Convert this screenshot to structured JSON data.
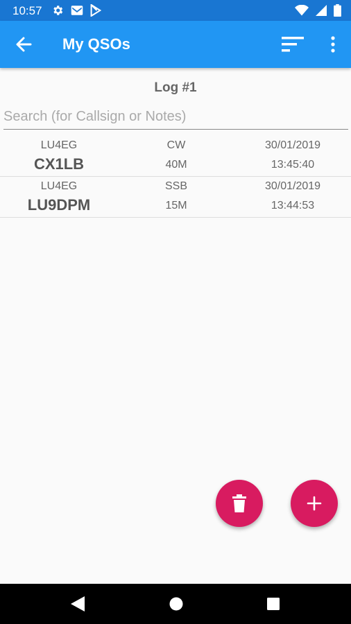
{
  "status_bar": {
    "time": "10:57",
    "icons_left": [
      "gear-icon",
      "gmail-icon",
      "play-store-icon"
    ],
    "icons_right": [
      "wifi-icon",
      "signal-icon",
      "battery-icon"
    ]
  },
  "app_bar": {
    "title": "My QSOs",
    "color": "#2196f3",
    "icons": [
      "back-arrow-icon",
      "sort-icon",
      "overflow-menu-icon"
    ]
  },
  "log": {
    "title": "Log #1"
  },
  "search": {
    "placeholder": "Search (for Callsign or Notes)",
    "value": ""
  },
  "qsos": [
    {
      "operator": "LU4EG",
      "callsign": "CX1LB",
      "mode": "CW",
      "band": "40M",
      "date": "30/01/2019",
      "time": "13:45:40"
    },
    {
      "operator": "LU4EG",
      "callsign": "LU9DPM",
      "mode": "SSB",
      "band": "15M",
      "date": "30/01/2019",
      "time": "13:44:53"
    }
  ],
  "fabs": {
    "delete_icon": "trash-icon",
    "add_icon": "plus-icon",
    "color": "#d81b60"
  },
  "nav_bar": {
    "icons": [
      "back-triangle-icon",
      "home-circle-icon",
      "recents-square-icon"
    ]
  }
}
